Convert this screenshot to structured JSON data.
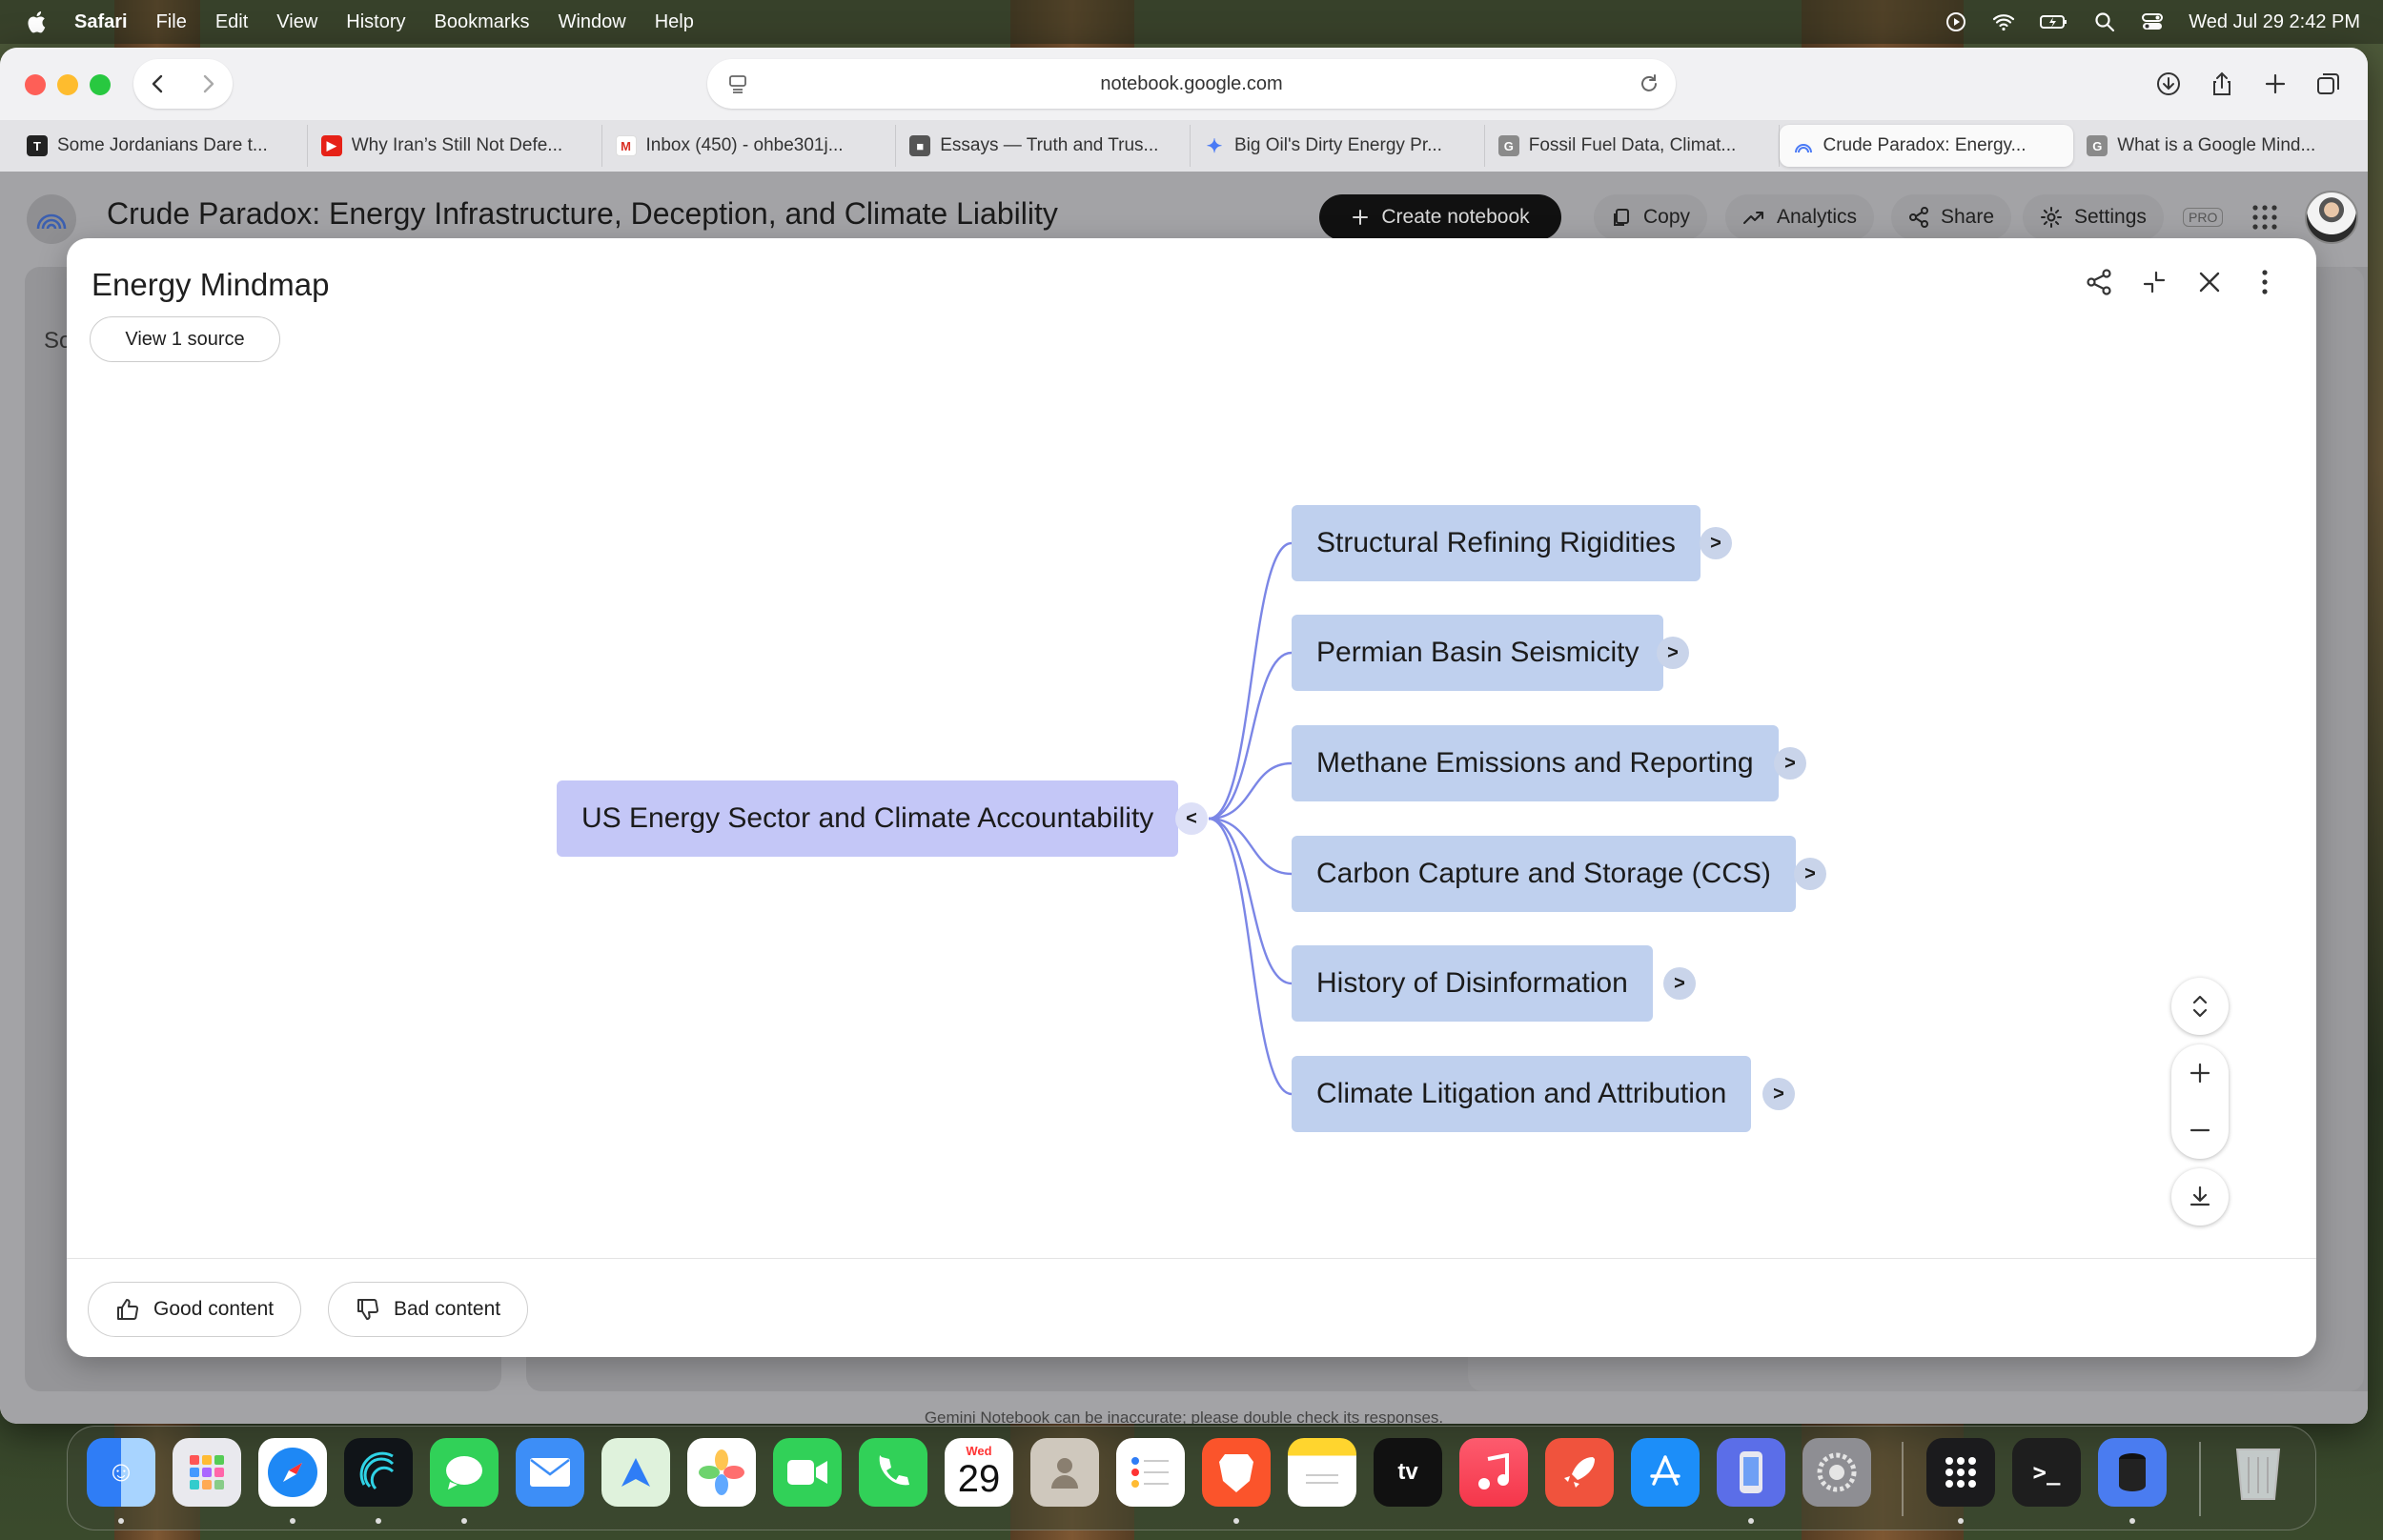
{
  "menubar": {
    "app_name": "Safari",
    "items": [
      "File",
      "Edit",
      "View",
      "History",
      "Bookmarks",
      "Window",
      "Help"
    ],
    "datetime": "Wed Jul 29  2:42 PM"
  },
  "browser": {
    "url": "notebook.google.com",
    "tabs": [
      {
        "label": "Some Jordanians Dare t...",
        "favicon": "nyt-icon",
        "color": "#222222"
      },
      {
        "label": "Why Iran’s Still Not Defe...",
        "favicon": "youtube-icon",
        "color": "#e62117"
      },
      {
        "label": "Inbox (450) - ohbe301j...",
        "favicon": "gmail-icon",
        "color": "#d93025"
      },
      {
        "label": "Essays — Truth and Trus...",
        "favicon": "cube-icon",
        "color": "#555555"
      },
      {
        "label": "Big Oil's Dirty Energy Pr...",
        "favicon": "gemini-icon",
        "color": "#4a7af5"
      },
      {
        "label": "Fossil Fuel Data, Climat...",
        "favicon": "google-g-icon",
        "color": "#777777"
      },
      {
        "label": "Crude Paradox: Energy...",
        "favicon": "notebook-icon",
        "color": "#4a7af5"
      },
      {
        "label": "What is a Google Mind...",
        "favicon": "google-g-icon",
        "color": "#777777"
      }
    ]
  },
  "app": {
    "notebook_title": "Crude Paradox: Energy Infrastructure, Deception, and Climate Liability",
    "create_label": "Create notebook",
    "copy_label": "Copy",
    "analytics_label": "Analytics",
    "share_label": "Share",
    "settings_label": "Settings",
    "pro_label": "PRO",
    "bg_sources_fragment": "So",
    "disclaimer": "Gemini Notebook can be inaccurate; please double check its responses."
  },
  "mindmap_modal": {
    "title": "Energy Mindmap",
    "view_source_label": "View 1 source",
    "root": {
      "label": "US Energy Sector and Climate Accountability",
      "toggle": "<"
    },
    "children": [
      {
        "label": "Structural Refining Rigidities",
        "toggle": ">"
      },
      {
        "label": "Permian Basin Seismicity",
        "toggle": ">"
      },
      {
        "label": "Methane Emissions and Reporting",
        "toggle": ">"
      },
      {
        "label": "Carbon Capture and Storage (CCS)",
        "toggle": ">"
      },
      {
        "label": "History of Disinformation",
        "toggle": ">"
      },
      {
        "label": "Climate Litigation and Attribution",
        "toggle": ">"
      }
    ],
    "good_label": "Good content",
    "bad_label": "Bad content"
  },
  "dock": {
    "calendar_month": "Wed",
    "calendar_day": "29",
    "apps": [
      "finder-icon",
      "launchpad-icon",
      "safari-icon",
      "stream-icon",
      "messages-icon",
      "mail-icon",
      "maps-icon",
      "photos-icon",
      "facetime-icon",
      "phone-icon",
      "calendar-icon",
      "contacts-icon",
      "reminders-icon",
      "brave-icon",
      "notes-icon",
      "appletv-icon",
      "music-icon",
      "rocket-icon",
      "appstore-icon",
      "simulator-icon",
      "settings-icon",
      "dots-icon",
      "terminal-icon",
      "cylinder-icon",
      "trash-icon"
    ]
  },
  "colors": {
    "root_node": "#c4c7f7",
    "child_node": "#bfd0ee",
    "connector": "#7b86e6"
  }
}
